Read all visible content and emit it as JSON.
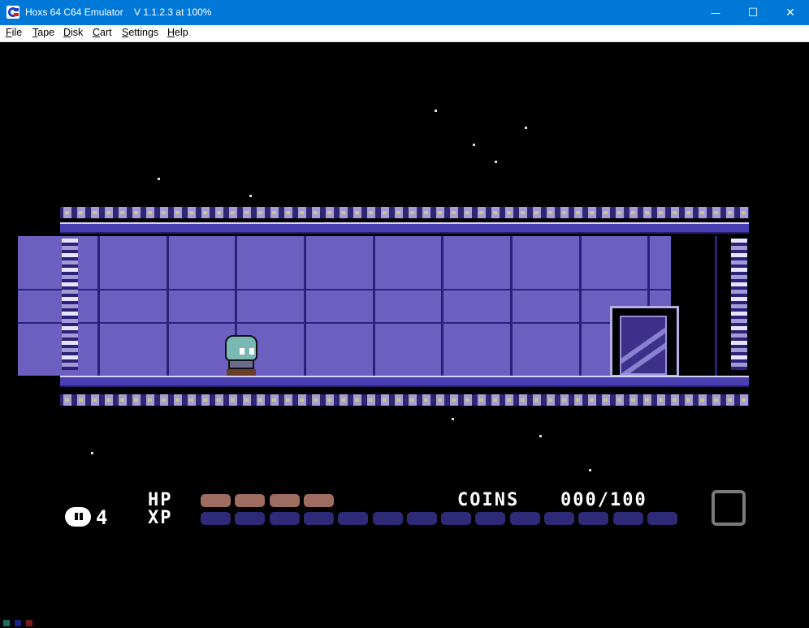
{
  "window": {
    "title": "Hoxs 64 C64 Emulator    V 1.1.2.3 at 100%",
    "controls": {
      "minimize": "—",
      "maximize": "☐",
      "close": "✕"
    },
    "title_bar_color": "#0078d7"
  },
  "menu": {
    "items": [
      {
        "label": "File"
      },
      {
        "label": "Tape"
      },
      {
        "label": "Disk"
      },
      {
        "label": "Cart"
      },
      {
        "label": "Settings"
      },
      {
        "label": "Help"
      }
    ]
  },
  "game": {
    "hud": {
      "lives_count": "4",
      "hp_label": "HP",
      "xp_label": "XP",
      "hp_filled": 4,
      "hp_total": 4,
      "xp_filled": 0,
      "xp_total": 14,
      "coins_label": "COINS",
      "coins_value": "000/100",
      "hp_color": "#9e6c60",
      "xp_color": "#2e2a78"
    },
    "colors": {
      "wall": "#6d5fbf",
      "frame_dark": "#2a2278",
      "highlight": "#e8e4ff"
    }
  }
}
